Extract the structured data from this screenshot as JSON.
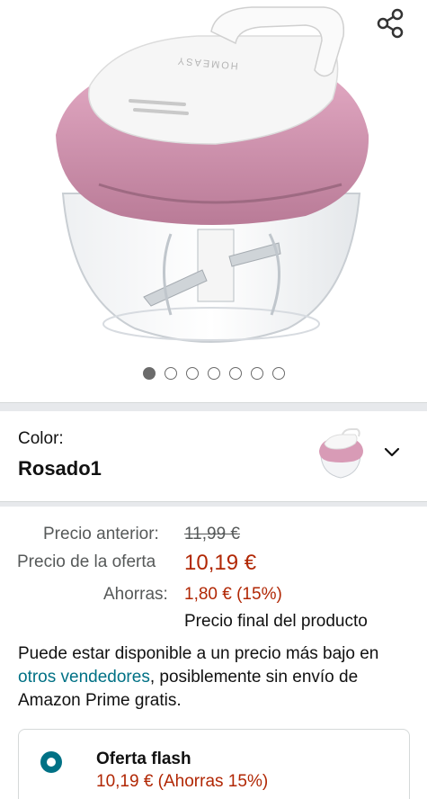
{
  "product": {
    "brand_text": "HOMEASY",
    "image_count": 7,
    "active_image_index": 0
  },
  "color": {
    "label": "Color:",
    "value": "Rosado1"
  },
  "pricing": {
    "previous_label": "Precio anterior:",
    "previous_value": "11,99 €",
    "deal_label": "Precio de la oferta",
    "deal_value": "10,19 €",
    "savings_label": "Ahorras:",
    "savings_value": "1,80 € (15%)",
    "final_note": "Precio final del producto"
  },
  "availability": {
    "text_before": "Puede estar disponible a un precio más bajo en ",
    "link_text": "otros vendedores",
    "text_after": ", posiblemente sin envío de Amazon Prime gratis."
  },
  "offer": {
    "title": "Oferta flash",
    "price_text": "10,19 € (Ahorras 15%)"
  },
  "colors": {
    "price_red": "#b12704",
    "link_teal": "#007185",
    "product_pink": "#d89bb6"
  }
}
